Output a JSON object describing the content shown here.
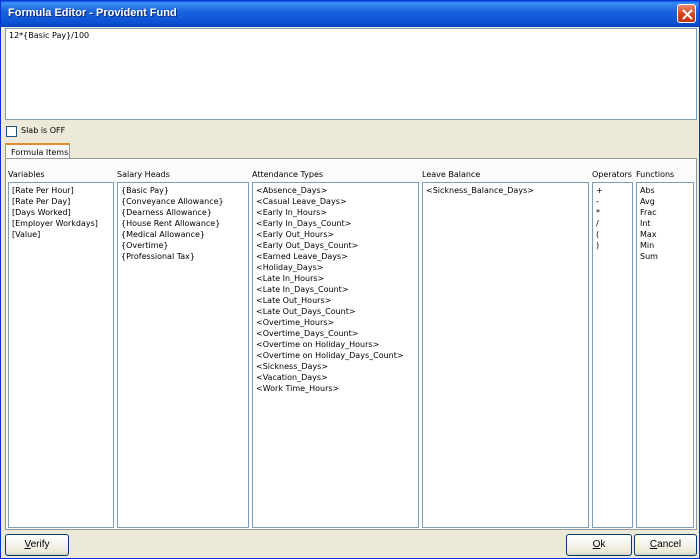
{
  "window": {
    "title": "Formula Editor - Provident Fund"
  },
  "formula": {
    "text": "12*{Basic Pay}/100"
  },
  "slab": {
    "label": "Slab is OFF",
    "checked": false
  },
  "tabs": [
    {
      "label": "Formula Items",
      "active": true
    }
  ],
  "columns": {
    "variables": {
      "header": "Variables",
      "items": [
        "[Rate Per Hour]",
        "[Rate Per Day]",
        "[Days Worked]",
        "[Employer Workdays]",
        "[Value]"
      ]
    },
    "salary_heads": {
      "header": "Salary Heads",
      "items": [
        "{Basic Pay}",
        "{Conveyance Allowance}",
        "{Dearness Allowance}",
        "{House Rent Allowance}",
        "{Medical Allowance}",
        "{Overtime}",
        "{Professional Tax}"
      ]
    },
    "attendance_types": {
      "header": "Attendance Types",
      "items": [
        "<Absence_Days>",
        "<Casual Leave_Days>",
        "<Early In_Hours>",
        "<Early In_Days_Count>",
        "<Early Out_Hours>",
        "<Early Out_Days_Count>",
        "<Earned Leave_Days>",
        "<Holiday_Days>",
        "<Late In_Hours>",
        "<Late In_Days_Count>",
        "<Late Out_Hours>",
        "<Late Out_Days_Count>",
        "<Overtime_Hours>",
        "<Overtime_Days_Count>",
        "<Overtime on Holiday_Hours>",
        "<Overtime on Holiday_Days_Count>",
        "<Sickness_Days>",
        "<Vacation_Days>",
        "<Work Time_Hours>"
      ]
    },
    "leave_balance": {
      "header": "Leave Balance",
      "items": [
        "<Sickness_Balance_Days>"
      ]
    },
    "operators": {
      "header": "Operators",
      "items": [
        "+",
        "-",
        "*",
        "/",
        "(",
        ")"
      ]
    },
    "functions": {
      "header": "Functions",
      "items": [
        "Abs",
        "Avg",
        "Frac",
        "Int",
        "Max",
        "Min",
        "Sum"
      ]
    }
  },
  "buttons": {
    "verify": "Verify",
    "ok": "Ok",
    "cancel": "Cancel"
  }
}
